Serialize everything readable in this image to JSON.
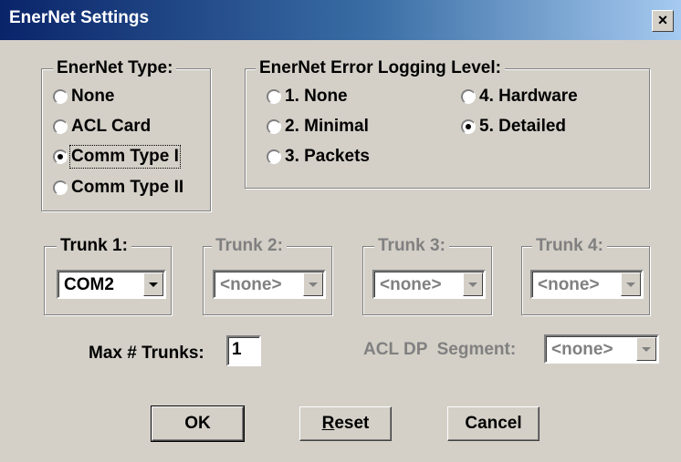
{
  "window": {
    "title": "EnerNet Settings",
    "close_label": "×"
  },
  "enernet_type": {
    "legend": "EnerNet Type:",
    "options": [
      "None",
      "ACL Card",
      "Comm Type I",
      "Comm Type II"
    ],
    "selected": "Comm Type I"
  },
  "error_logging": {
    "legend": "EnerNet Error Logging Level:",
    "options": [
      "1. None",
      "2. Minimal",
      "3. Packets",
      "4. Hardware",
      "5. Detailed"
    ],
    "selected": "5. Detailed"
  },
  "trunks": [
    {
      "legend": "Trunk 1:",
      "value": "COM2",
      "enabled": true
    },
    {
      "legend": "Trunk 2:",
      "value": "<none>",
      "enabled": false
    },
    {
      "legend": "Trunk 3:",
      "value": "<none>",
      "enabled": false
    },
    {
      "legend": "Trunk 4:",
      "value": "<none>",
      "enabled": false
    }
  ],
  "max_trunks": {
    "label": "Max # Trunks:",
    "value": "1"
  },
  "acl_dp_segment": {
    "label": "ACL DP  Segment:",
    "value": "<none>",
    "enabled": false
  },
  "buttons": {
    "ok": "OK",
    "reset_mnemonic": "R",
    "reset_rest": "eset",
    "cancel": "Cancel"
  }
}
